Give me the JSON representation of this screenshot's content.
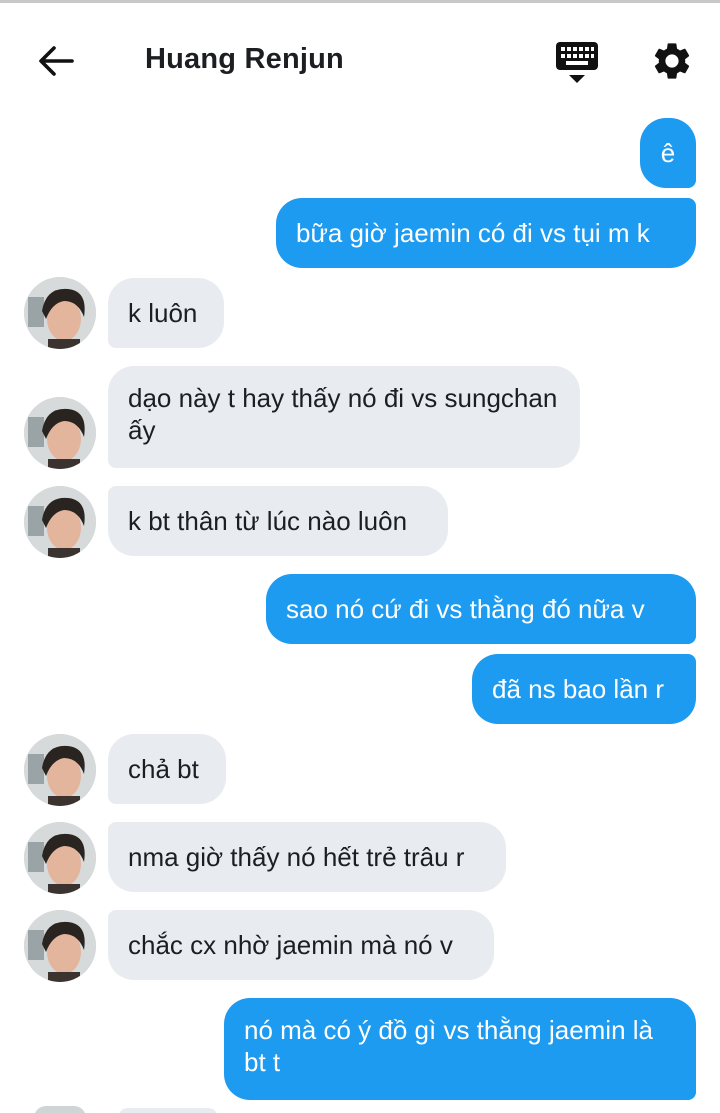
{
  "header": {
    "title": "Huang Renjun"
  },
  "messages": [
    {
      "side": "out",
      "text": "ê"
    },
    {
      "side": "out",
      "text": "bữa giờ jaemin có đi vs tụi m k"
    },
    {
      "side": "in",
      "text": "k luôn"
    },
    {
      "side": "in",
      "text": "dạo này t hay thấy nó đi vs sungchan ấy"
    },
    {
      "side": "in",
      "text": "k bt thân từ lúc nào luôn"
    },
    {
      "side": "out",
      "text": "sao nó cứ đi vs thằng đó nữa v"
    },
    {
      "side": "out",
      "text": "đã ns bao lần r"
    },
    {
      "side": "in",
      "text": "chả bt"
    },
    {
      "side": "in",
      "text": "nma giờ thấy nó hết trẻ trâu r"
    },
    {
      "side": "in",
      "text": "chắc cx nhờ jaemin mà nó v"
    },
    {
      "side": "out",
      "text": "nó mà có ý đồ gì vs thằng jaemin là bt t"
    }
  ],
  "colors": {
    "outgoing_bubble": "#1d9bf0",
    "incoming_bubble": "#e8ebef"
  },
  "icons": [
    "back-arrow-icon",
    "keyboard-icon",
    "gear-icon",
    "avatar"
  ]
}
